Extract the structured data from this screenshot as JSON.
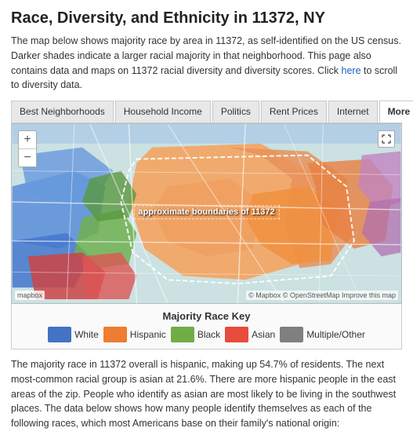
{
  "page": {
    "title": "Race, Diversity, and Ethnicity in 11372, NY",
    "description_part1": "The map below shows majority race by area in 11372, as self-identified on the US census. Darker shades indicate a larger racial majority in that neighborhood. This page also contains data and maps on 11372 racial diversity and diversity scores. Click ",
    "description_link": "here",
    "description_part2": " to scroll to diversity data.",
    "bottom_text": "The majority race in 11372 overall is hispanic, making up 54.7% of residents. The next most-common racial group is asian at 21.6%. There are more hispanic people in the east areas of the zip. People who identify as asian are most likely to be living in the southwest places. The data below shows how many people identify themselves as each of the following races, which most Americans base on their family's national origin:"
  },
  "nav": {
    "tabs": [
      {
        "label": "Best Neighborhoods",
        "active": false
      },
      {
        "label": "Household Income",
        "active": false
      },
      {
        "label": "Politics",
        "active": false
      },
      {
        "label": "Rent Prices",
        "active": false
      },
      {
        "label": "Internet",
        "active": false
      },
      {
        "label": "More",
        "active": true
      }
    ]
  },
  "map": {
    "overlay_label": "approximate boundaries of 11372",
    "zoom_in": "+",
    "zoom_out": "−",
    "logo": "mapbox",
    "attribution": "© Mapbox © OpenStreetMap Improve this map"
  },
  "legend": {
    "title": "Majority Race Key",
    "items": [
      {
        "label": "White",
        "color": "#4472c4"
      },
      {
        "label": "Hispanic",
        "color": "#ed7d31"
      },
      {
        "label": "Black",
        "color": "#70ad47"
      },
      {
        "label": "Asian",
        "color": "#e74c3c"
      },
      {
        "label": "Multiple/Other",
        "color": "#7f7f7f"
      }
    ]
  }
}
